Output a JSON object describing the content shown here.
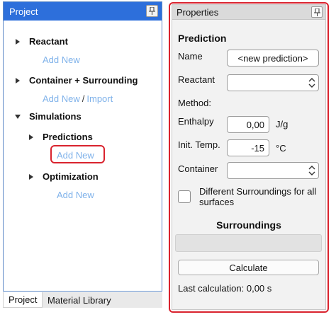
{
  "left_panel": {
    "title": "Project",
    "tree": [
      {
        "label": "Reactant",
        "link": "Add New"
      },
      {
        "label": "Container + Surrounding",
        "link": "Add New",
        "link2": "Import",
        "sep": "/"
      },
      {
        "label": "Simulations"
      },
      {
        "label": "Predictions",
        "link": "Add New"
      },
      {
        "label": "Optimization",
        "link": "Add New"
      }
    ],
    "tabs": [
      "Project",
      "Material Library"
    ]
  },
  "properties": {
    "title": "Properties",
    "section_title": "Prediction",
    "name_label": "Name",
    "name_value": "<new prediction>",
    "reactant_label": "Reactant",
    "reactant_value": "",
    "method_label": "Method:",
    "enthalpy_label": "Enthalpy",
    "enthalpy_value": "0,00",
    "enthalpy_unit": "J/g",
    "init_temp_label": "Init. Temp.",
    "init_temp_value": "-15",
    "init_temp_unit": "°C",
    "container_label": "Container",
    "container_value": "",
    "different_surroundings_label": "Different Surroundings for all surfaces",
    "surroundings_title": "Surroundings",
    "calculate_label": "Calculate",
    "last_calc_label": "Last calculation:",
    "last_calc_value": "0,00",
    "last_calc_unit": "s"
  },
  "colors": {
    "header_blue": "#2d6fdb",
    "link_blue": "#7fb2ea",
    "highlight_red": "#d9232e"
  },
  "icons": [
    "pin-icon",
    "expand-arrow-icon",
    "collapse-arrow-icon",
    "combo-arrows-icon"
  ]
}
